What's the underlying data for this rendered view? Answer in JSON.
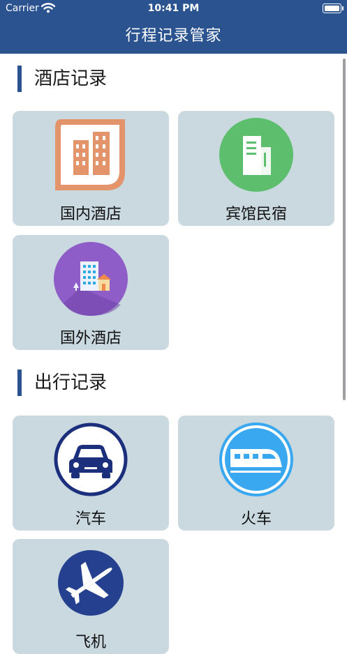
{
  "status_bar": {
    "carrier": "Carrier",
    "time": "10:41 PM"
  },
  "nav": {
    "title": "行程记录管家"
  },
  "sections": {
    "hotel": {
      "title": "酒店记录",
      "items": [
        "国内酒店",
        "宾馆民宿",
        "国外酒店"
      ]
    },
    "travel": {
      "title": "出行记录",
      "items": [
        "汽车",
        "火车",
        "飞机"
      ]
    }
  },
  "icons": {
    "domestic_hotel": "hotel-buildings-icon",
    "guesthouse": "document-icon",
    "foreign_hotel": "city-icon",
    "car": "car-icon",
    "train": "train-icon",
    "plane": "airplane-icon"
  },
  "colors": {
    "nav_bg": "#2b5390",
    "tile_bg": "#cad9e0",
    "accent_bar": "#2b5390",
    "orange": "#e3946a",
    "green": "#5dbe6e",
    "purple": "#8f5dc8",
    "navy": "#1b2f7d",
    "sky": "#3aa8f0"
  }
}
